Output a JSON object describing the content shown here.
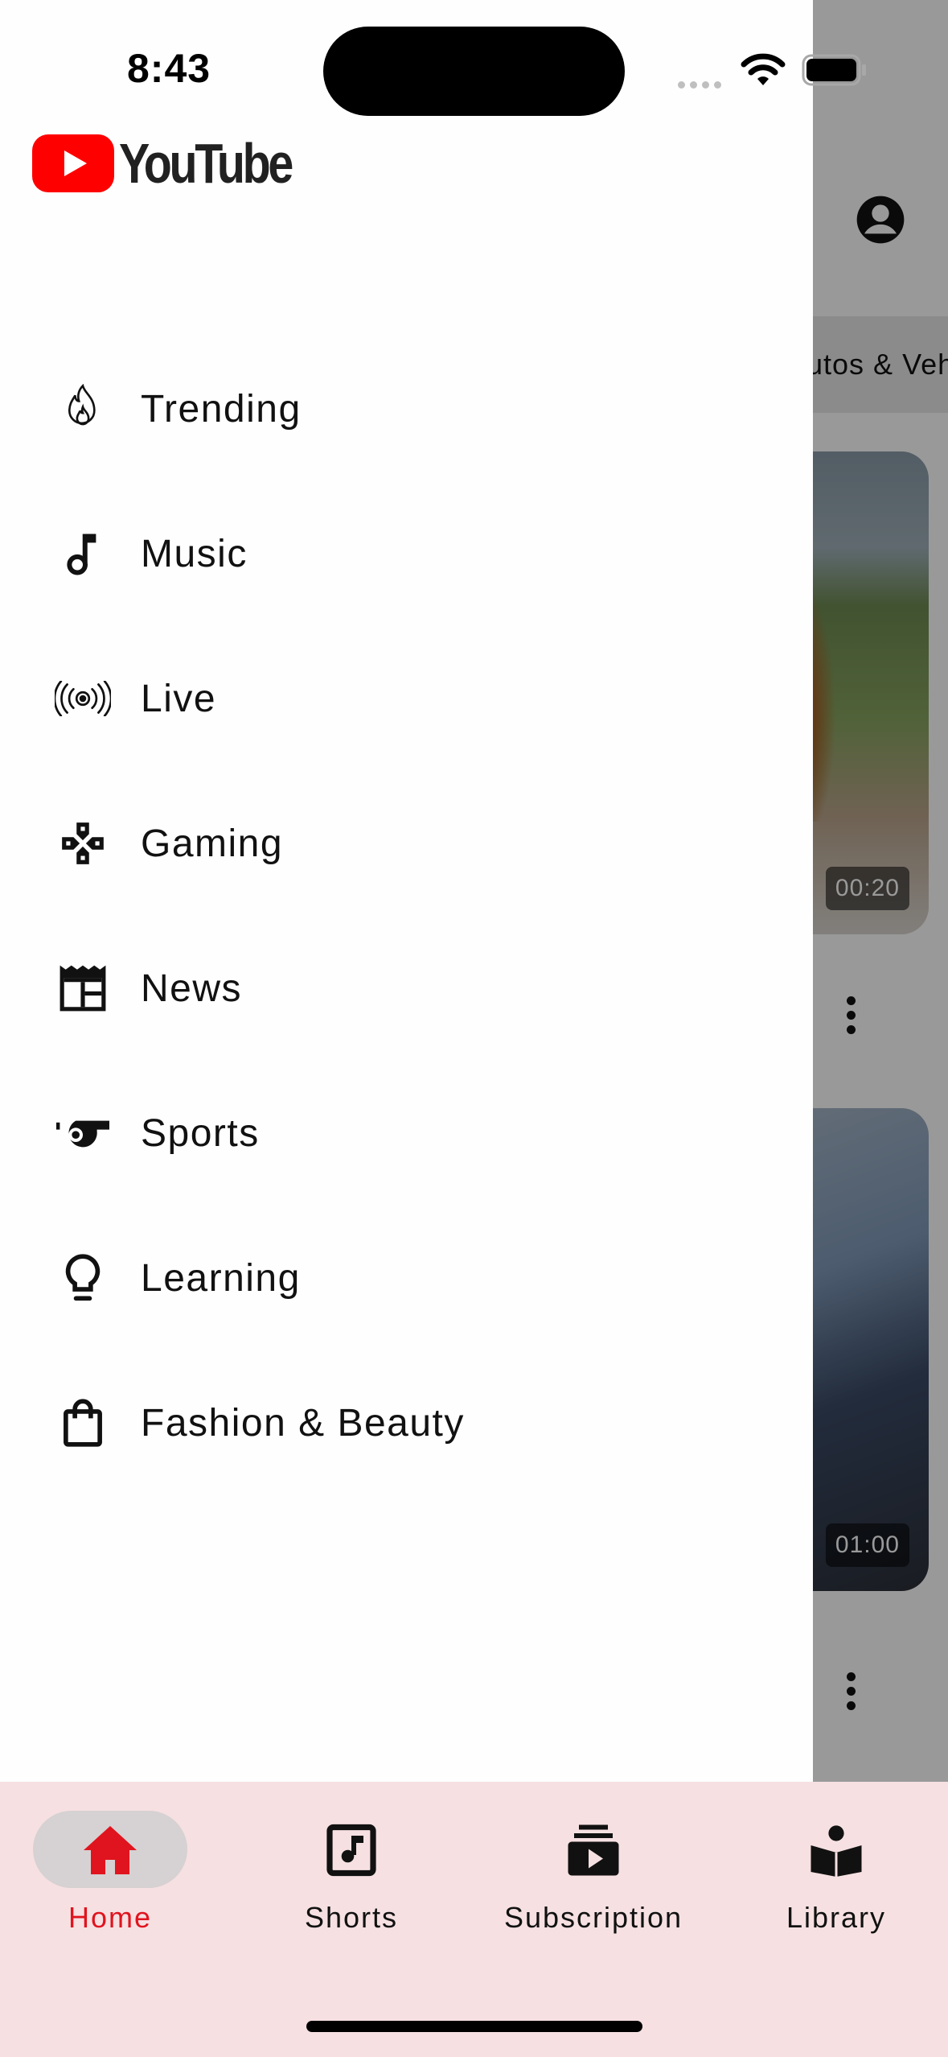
{
  "status_bar": {
    "time": "8:43"
  },
  "app": {
    "logo_text": "YouTube",
    "brand_color": "#FF0000"
  },
  "background_feed": {
    "chip_text": "Autos & Vehicles",
    "videos": [
      {
        "duration": "00:20"
      },
      {
        "duration": "01:00"
      }
    ]
  },
  "drawer": {
    "items": [
      {
        "label": "Trending",
        "icon": "fire-icon"
      },
      {
        "label": "Music",
        "icon": "music-note-icon"
      },
      {
        "label": "Live",
        "icon": "live-broadcast-icon"
      },
      {
        "label": "Gaming",
        "icon": "gamepad-icon"
      },
      {
        "label": "News",
        "icon": "newspaper-icon"
      },
      {
        "label": "Sports",
        "icon": "whistle-icon"
      },
      {
        "label": "Learning",
        "icon": "lightbulb-icon"
      },
      {
        "label": "Fashion & Beauty",
        "icon": "shopping-bag-icon"
      }
    ]
  },
  "bottom_nav": {
    "active_color": "#E0141E",
    "items": [
      {
        "label": "Home",
        "icon": "home-icon",
        "active": true
      },
      {
        "label": "Shorts",
        "icon": "shorts-icon",
        "active": false
      },
      {
        "label": "Subscription",
        "icon": "subscriptions-icon",
        "active": false
      },
      {
        "label": "Library",
        "icon": "library-icon",
        "active": false
      }
    ]
  }
}
